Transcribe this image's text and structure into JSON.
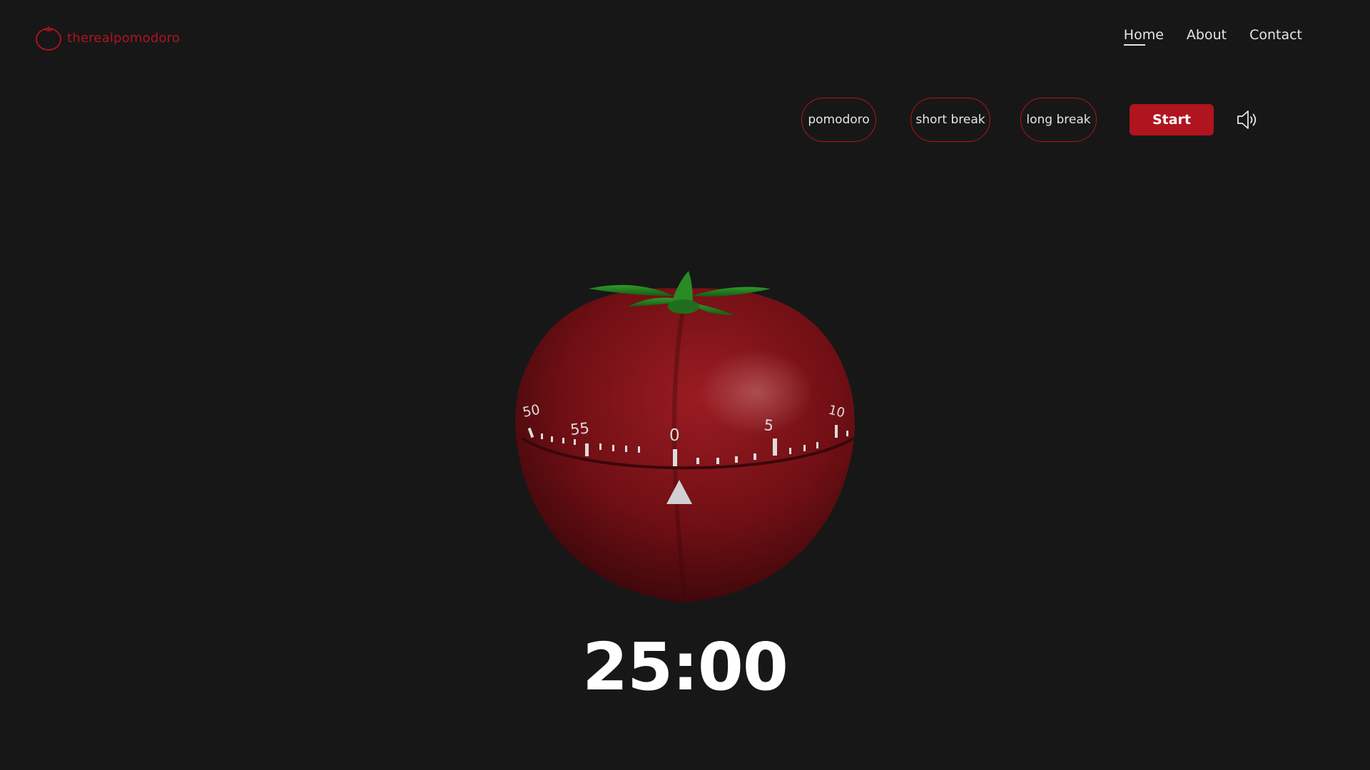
{
  "header": {
    "logo_text": "therealpomodoro",
    "nav": [
      {
        "label": "Home",
        "active": true
      },
      {
        "label": "About",
        "active": false
      },
      {
        "label": "Contact",
        "active": false
      }
    ]
  },
  "toolbar": {
    "modes": [
      {
        "label": "pomodoro"
      },
      {
        "label": "short break"
      },
      {
        "label": "long break"
      }
    ],
    "start_label": "Start",
    "sound_icon": "speaker-icon"
  },
  "dial": {
    "labels": [
      "50",
      "55",
      "0",
      "5",
      "10"
    ]
  },
  "timer": {
    "display": "25:00"
  },
  "colors": {
    "background": "#171717",
    "accent": "#b0141f",
    "text": "#e6e6e6"
  }
}
